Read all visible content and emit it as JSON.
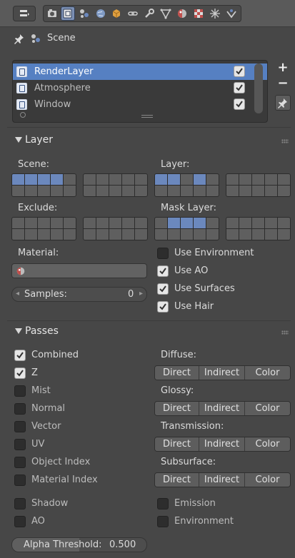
{
  "header": {
    "icons": [
      "editor-type-icon",
      "render-icon",
      "render-layers-icon",
      "scene-icon",
      "world-icon",
      "object-icon",
      "constraints-icon",
      "modifiers-icon",
      "data-icon",
      "material-icon",
      "texture-icon",
      "particles-icon",
      "physics-icon"
    ]
  },
  "context": {
    "breadcrumb": "Scene"
  },
  "layers_list": {
    "items": [
      {
        "label": "RenderLayer",
        "enabled": true,
        "selected": true
      },
      {
        "label": "Atmosphere",
        "enabled": true,
        "selected": false
      },
      {
        "label": "Window",
        "enabled": true,
        "selected": false
      }
    ],
    "add_label": "+",
    "remove_label": "−"
  },
  "layer_panel": {
    "title": "Layer",
    "scene_label": "Scene:",
    "layer_label": "Layer:",
    "exclude_label": "Exclude:",
    "mask_label": "Mask Layer:",
    "material_label": "Material:",
    "samples_label": "Samples:",
    "samples_value": "0",
    "toggles": [
      {
        "label": "Use Environment",
        "checked": false
      },
      {
        "label": "Use AO",
        "checked": true
      },
      {
        "label": "Use Surfaces",
        "checked": true
      },
      {
        "label": "Use Hair",
        "checked": true
      }
    ]
  },
  "passes_panel": {
    "title": "Passes",
    "left": [
      {
        "label": "Combined",
        "checked": true
      },
      {
        "label": "Z",
        "checked": true
      },
      {
        "label": "Mist",
        "checked": false
      },
      {
        "label": "Normal",
        "checked": false
      },
      {
        "label": "Vector",
        "checked": false
      },
      {
        "label": "UV",
        "checked": false
      },
      {
        "label": "Object Index",
        "checked": false
      },
      {
        "label": "Material Index",
        "checked": false
      }
    ],
    "groups": [
      {
        "label": "Diffuse:"
      },
      {
        "label": "Glossy:"
      },
      {
        "label": "Transmission:"
      },
      {
        "label": "Subsurface:"
      }
    ],
    "buttons": {
      "direct": "Direct",
      "indirect": "Indirect",
      "color": "Color"
    },
    "bottom_left": [
      {
        "label": "Shadow",
        "checked": false
      },
      {
        "label": "AO",
        "checked": false
      }
    ],
    "bottom_right": [
      {
        "label": "Emission",
        "checked": false
      },
      {
        "label": "Environment",
        "checked": false
      }
    ],
    "alpha_label": "Alpha Threshold:",
    "alpha_value": "0.500",
    "alpha_fraction": 0.5
  },
  "colors": {
    "selection": "#5680c2",
    "panel": "#474747",
    "header": "#5a5a5a"
  }
}
